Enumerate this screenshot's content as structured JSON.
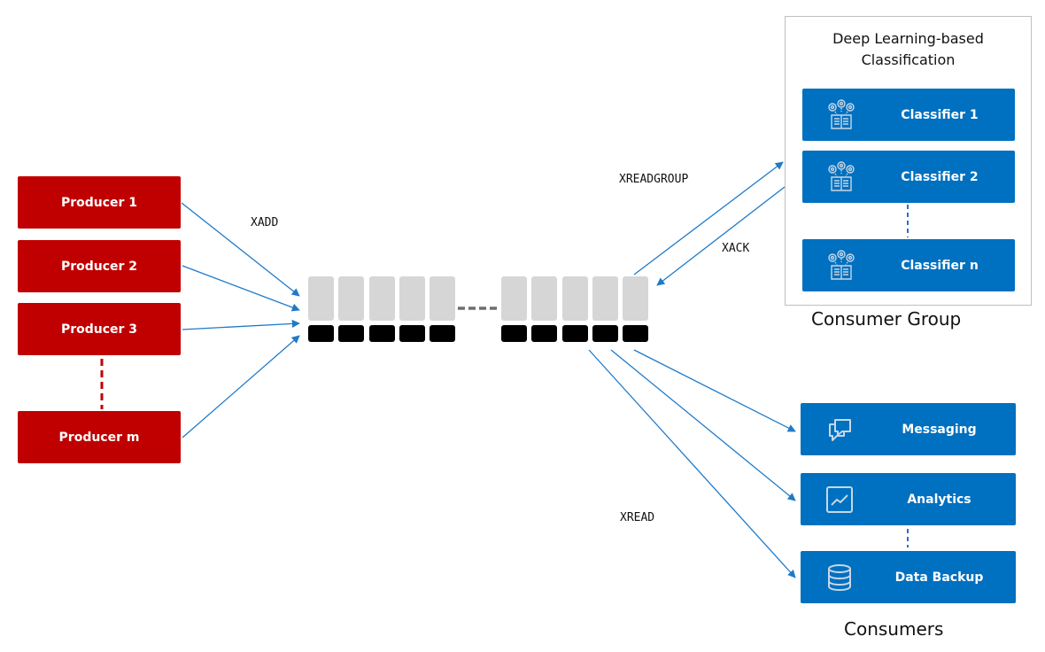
{
  "producers": [
    {
      "label": "Producer 1"
    },
    {
      "label": "Producer 2"
    },
    {
      "label": "Producer 3"
    },
    {
      "label": "Producer m"
    }
  ],
  "commands": {
    "xadd": "XADD",
    "xreadgroup": "XREADGROUP",
    "xack": "XACK",
    "xread": "XREAD"
  },
  "stream": {
    "left_entries": 5,
    "right_entries": 5
  },
  "consumer_group": {
    "title_line1": "Deep Learning-based",
    "title_line2": "Classification",
    "caption": "Consumer Group",
    "classifiers": [
      {
        "label": "Classifier 1",
        "icon": "gears-book-icon"
      },
      {
        "label": "Classifier 2",
        "icon": "gears-book-icon"
      },
      {
        "label": "Classifier n",
        "icon": "gears-book-icon"
      }
    ]
  },
  "consumers": {
    "caption": "Consumers",
    "items": [
      {
        "label": "Messaging",
        "icon": "chat-bubbles-icon"
      },
      {
        "label": "Analytics",
        "icon": "line-chart-icon"
      },
      {
        "label": "Data Backup",
        "icon": "database-icon"
      }
    ]
  },
  "colors": {
    "producer": "#c00000",
    "consumer": "#0070c0",
    "arrow": "#1f7ac8",
    "stream_entry": "#d6d6d6",
    "stream_id": "#000000"
  }
}
